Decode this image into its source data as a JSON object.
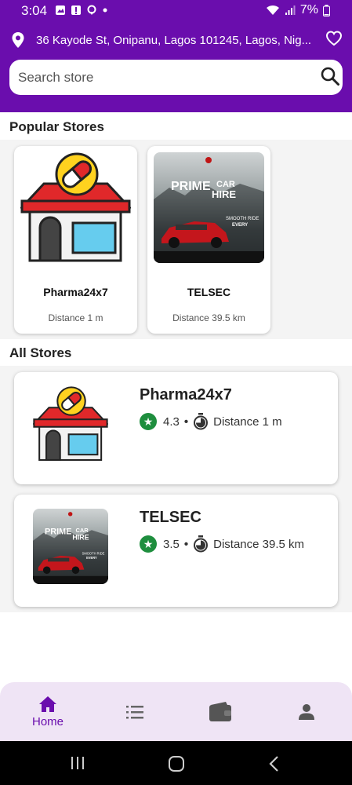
{
  "status_bar": {
    "time": "3:04",
    "battery": "7%"
  },
  "header": {
    "address": "36 Kayode St, Onipanu, Lagos 101245, Lagos, Nig...",
    "search_placeholder": "Search store"
  },
  "popular": {
    "title": "Popular Stores",
    "stores": [
      {
        "name": "Pharma24x7",
        "distance": "Distance 1 m"
      },
      {
        "name": "TELSEC",
        "distance": "Distance 39.5 km"
      }
    ]
  },
  "all_stores": {
    "title": "All Stores",
    "stores": [
      {
        "name": "Pharma24x7",
        "rating": "4.3",
        "distance": "Distance 1 m"
      },
      {
        "name": "TELSEC",
        "rating": "3.5",
        "distance": "Distance 39.5 km"
      }
    ]
  },
  "poster": {
    "word1": "PRIME",
    "word2": "CAR",
    "word3": "HIRE",
    "tagline": "SMOOTH RIDE",
    "tagline2": "EVERY"
  },
  "bottom_nav": {
    "home_label": "Home",
    "active": "home"
  },
  "colors": {
    "brand": "#6a0dad",
    "nav_bg": "#efe4f5",
    "rating_badge": "#1e8e3e"
  }
}
